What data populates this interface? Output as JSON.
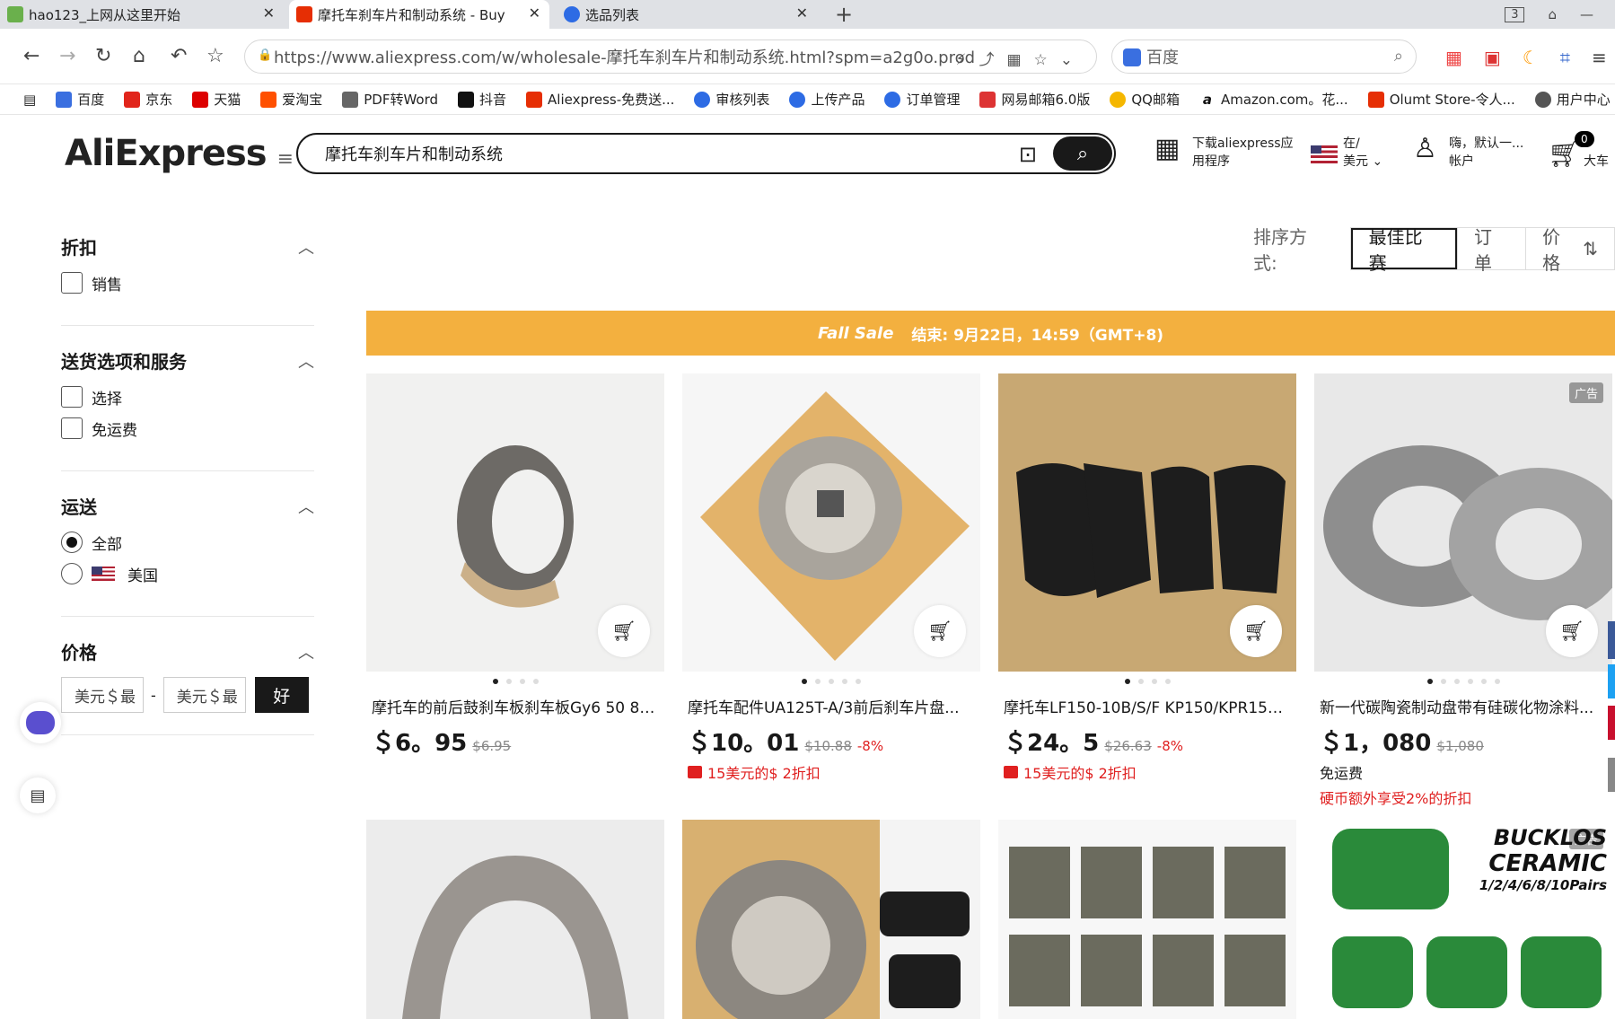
{
  "browser": {
    "tabs": [
      {
        "title": "hao123_上网从这里开始",
        "color": "#6ab04c"
      },
      {
        "title": "摩托车刹车片和制动系统 - Buy",
        "color": "#e62e04"
      },
      {
        "title": "选品列表",
        "color": "#2d6be4"
      }
    ],
    "new_tab": "+",
    "window_count": "3",
    "url": "https://www.aliexpress.com/w/wholesale-摩托车刹车片和制动系统.html?spm=a2g0o.prod...",
    "search_engine": "百度",
    "bookmarks": [
      "百度",
      "京东",
      "天猫",
      "爱淘宝",
      "PDF转Word",
      "抖音",
      "Aliexpress-免费送...",
      "审核列表",
      "上传产品",
      "订单管理",
      "网易邮箱6.0版",
      "QQ邮箱",
      "Amazon.com。花...",
      "Olumt Store-令人...",
      "用户中心"
    ]
  },
  "header": {
    "logo": "AliExpress",
    "search_value": "摩托车刹车片和制动系统",
    "app_download_line1": "下载aliexpress应",
    "app_download_line2": "用程序",
    "region_line1": "在/",
    "region_line2": "美元",
    "account_line1": "嗨，默认一...",
    "account_line2": "帐户",
    "cart_count": "0",
    "cart_label": "大车"
  },
  "filters": {
    "discount": {
      "title": "折扣",
      "options": [
        "销售"
      ]
    },
    "delivery": {
      "title": "送货选项和服务",
      "options": [
        "选择",
        "免运费"
      ]
    },
    "shipping": {
      "title": "运送",
      "options": [
        "全部",
        "美国"
      ],
      "selected": "全部"
    },
    "price": {
      "title": "价格",
      "min_placeholder": "美元＄最",
      "max_placeholder": "美元＄最",
      "dash": "-",
      "ok": "好"
    }
  },
  "sort": {
    "label": "排序方式:",
    "options": [
      "最佳比赛",
      "订单",
      "价格"
    ],
    "selected": "最佳比赛"
  },
  "banner": {
    "brand": "Fall Sale",
    "text": "结束:  9月22日，14:59（GMT+8)"
  },
  "products": [
    {
      "title": "摩托车的前后鼓刹车板刹车板Gy6 50 80...",
      "price": "＄6。95",
      "old": "$6.95",
      "pct": "",
      "promo": "",
      "ship": "",
      "coin": "",
      "ad": false,
      "dots": 4
    },
    {
      "title": "摩托车配件UA125T-A/3前后刹车片盘...",
      "price": "＄10。01",
      "old": "$10.88",
      "pct": "-8%",
      "promo": "15美元的$ 2折扣",
      "ship": "",
      "coin": "",
      "ad": false,
      "dots": 5
    },
    {
      "title": "摩托车LF150-10B/S/F KP150/KPR150...",
      "price": "＄24。5",
      "old": "$26.63",
      "pct": "-8%",
      "promo": "15美元的$ 2折扣",
      "ship": "",
      "coin": "",
      "ad": false,
      "dots": 4
    },
    {
      "title": "新一代碳陶瓷制动盘带有硅碳化物涂料...",
      "price": "＄1，080",
      "old": "$1,080",
      "pct": "",
      "promo": "",
      "ship": "免运费",
      "coin": "硬币额外享受2%的折扣",
      "ad": true,
      "ad_label": "广告",
      "dots": 6
    }
  ],
  "row2": [
    {
      "ad": false
    },
    {
      "ad": false
    },
    {
      "ad": false
    },
    {
      "ad": true,
      "ad_label": "广告",
      "brand_line1": "BUCKLOS",
      "brand_line2": "CERAMIC",
      "brand_line3": "1/2/4/6/8/10Pairs"
    }
  ]
}
